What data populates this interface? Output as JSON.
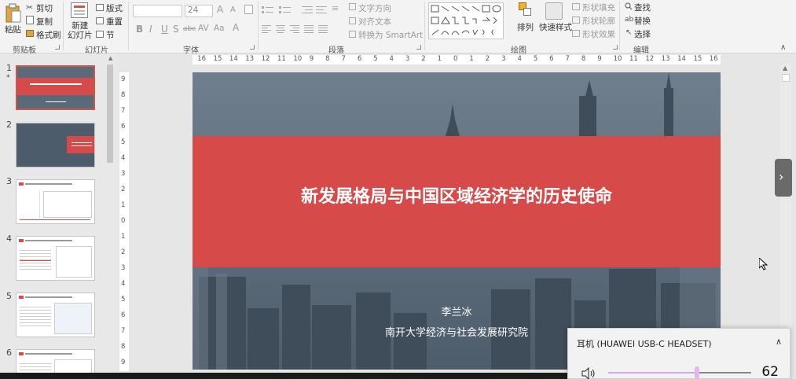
{
  "ribbon": {
    "clipboard": {
      "group_label": "剪贴板",
      "paste_label": "粘贴",
      "cut_label": "剪切",
      "copy_label": "复制",
      "format_painter_label": "格式刷"
    },
    "slides": {
      "group_label": "幻灯片",
      "new_slide_label": "新建\n幻灯片",
      "layout_label": "版式",
      "reset_label": "重置",
      "section_label": "节"
    },
    "font": {
      "group_label": "字体",
      "font_name": "",
      "font_size": "24",
      "bold": "B",
      "italic": "I",
      "underline": "U",
      "shadow": "S",
      "strike": "abc",
      "spacing": "AV",
      "case": "Aa",
      "grow": "A",
      "shrink": "A"
    },
    "paragraph": {
      "group_label": "段落",
      "text_direction_label": "文字方向",
      "align_text_label": "对齐文本",
      "smartart_label": "转换为 SmartArt"
    },
    "drawing": {
      "group_label": "绘图",
      "arrange_label": "排列",
      "quick_styles_label": "快速样式",
      "shape_fill_label": "形状填充",
      "shape_outline_label": "形状轮廓",
      "shape_effects_label": "形状效果"
    },
    "editing": {
      "group_label": "编辑",
      "find_label": "查找",
      "replace_label": "替换",
      "select_label": "选择"
    }
  },
  "thumbnails": [
    {
      "number": "1",
      "star": "*"
    },
    {
      "number": "2"
    },
    {
      "number": "3"
    },
    {
      "number": "4"
    },
    {
      "number": "5"
    },
    {
      "number": "6"
    }
  ],
  "rulers": {
    "horizontal": [
      "16",
      "15",
      "14",
      "13",
      "12",
      "11",
      "10",
      "9",
      "8",
      "7",
      "6",
      "5",
      "4",
      "3",
      "2",
      "1",
      "0",
      "1",
      "2",
      "3",
      "4",
      "5",
      "6",
      "7",
      "8",
      "9",
      "10",
      "11",
      "12",
      "13",
      "14",
      "15",
      "16"
    ],
    "vertical": [
      "9",
      "8",
      "7",
      "6",
      "5",
      "4",
      "3",
      "2",
      "1",
      "0",
      "1",
      "2",
      "3",
      "4",
      "5",
      "6",
      "7",
      "8",
      "9"
    ]
  },
  "slide": {
    "title": "新发展格局与中国区域经济学的历史使命",
    "author": "李兰冰",
    "institution": "南开大学经济与社会发展研究院",
    "band_color": "#d64a4a",
    "background_color": "#5b6a78"
  },
  "volume": {
    "device_label": "耳机 (HUAWEI USB-C HEADSET)",
    "value": "62",
    "level_fraction": 0.62
  },
  "colors": {
    "accent": "#c55a4a",
    "slider": "#d6a8e6"
  }
}
